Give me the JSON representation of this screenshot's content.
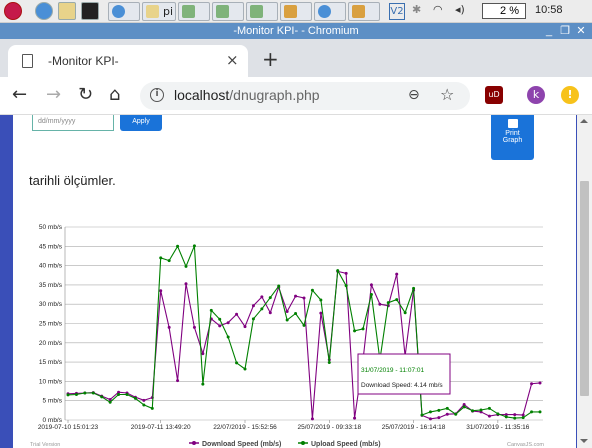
{
  "taskbar": {
    "cpu": "2 %",
    "clock": "10:58",
    "vnc": "V2"
  },
  "window": {
    "title": "-Monitor KPI- - Chromium"
  },
  "tab": {
    "title": "-Monitor KPI-"
  },
  "omnibox": {
    "host": "localhost",
    "path": "/dnugraph.php"
  },
  "profile": {
    "initial": "k"
  },
  "form": {
    "date_placeholder": "dd/mm/yyyy",
    "apply_label": "Apply",
    "print_label_1": "Print",
    "print_label_2": "Graph"
  },
  "page": {
    "heading": "tarihli ölçümler."
  },
  "chart_data": {
    "type": "line",
    "ylim": [
      0,
      50
    ],
    "yticks": [
      "0 mb/s",
      "5 mb/s",
      "10 mb/s",
      "15 mb/s",
      "20 mb/s",
      "25 mb/s",
      "30 mb/s",
      "35 mb/s",
      "40 mb/s",
      "45 mb/s",
      "50 mb/s"
    ],
    "xticks": [
      "2019-07-10 15:01:23",
      "2019-07-11 13:49:20",
      "22/07/2019 - 15:52:56",
      "25/07/2019 - 09:33:18",
      "25/07/2019 - 16:14:18",
      "31/07/2019 - 11:35:16"
    ],
    "series": [
      {
        "name": "Download Speed (mb/s)",
        "color": "#800080",
        "values": [
          6.8,
          6.9,
          7.0,
          7.1,
          6.2,
          5.3,
          7.2,
          7.0,
          5.9,
          5.1,
          5.8,
          33.5,
          24.0,
          10.2,
          35.3,
          24.0,
          17.2,
          26.2,
          24.4,
          25.2,
          27.4,
          24.2,
          29.6,
          31.9,
          27.8,
          34.4,
          28.1,
          32.1,
          31.6,
          0.3,
          27.7,
          15.6,
          38.5,
          38.0,
          0.5,
          15.5,
          35.0,
          30.0,
          29.6,
          37.8,
          16.6,
          33.6,
          1.2,
          0.3,
          0.6,
          1.5,
          1.6,
          4.0,
          2.3,
          2.1,
          1.0,
          1.4,
          1.4,
          1.4,
          1.3,
          9.4,
          9.6
        ]
      },
      {
        "name": "Upload Speed (mb/s)",
        "color": "#008000",
        "values": [
          6.5,
          6.6,
          7.0,
          7.0,
          6.0,
          4.6,
          6.6,
          6.6,
          5.6,
          3.9,
          3.0,
          42.0,
          41.3,
          45.0,
          39.8,
          45.1,
          9.3,
          28.4,
          26.1,
          21.5,
          14.8,
          13.2,
          26.2,
          28.8,
          31.7,
          34.7,
          25.9,
          27.6,
          24.5,
          33.6,
          31.1,
          14.9,
          38.7,
          34.8,
          23.1,
          23.6,
          32.5,
          15.6,
          30.4,
          31.2,
          27.8,
          34.1,
          1.3,
          2.1,
          2.5,
          3.0,
          1.5,
          3.4,
          2.4,
          2.6,
          3.0,
          1.6,
          0.8,
          0.5,
          0.6,
          2.1,
          2.1
        ]
      }
    ]
  },
  "tooltip": {
    "time": "31/07/2019 - 11:07:01",
    "label": "Download Speed: 4.14 mb/s"
  },
  "footer": {
    "trial": "Trial Version",
    "credit": "CanvasJS.com"
  }
}
